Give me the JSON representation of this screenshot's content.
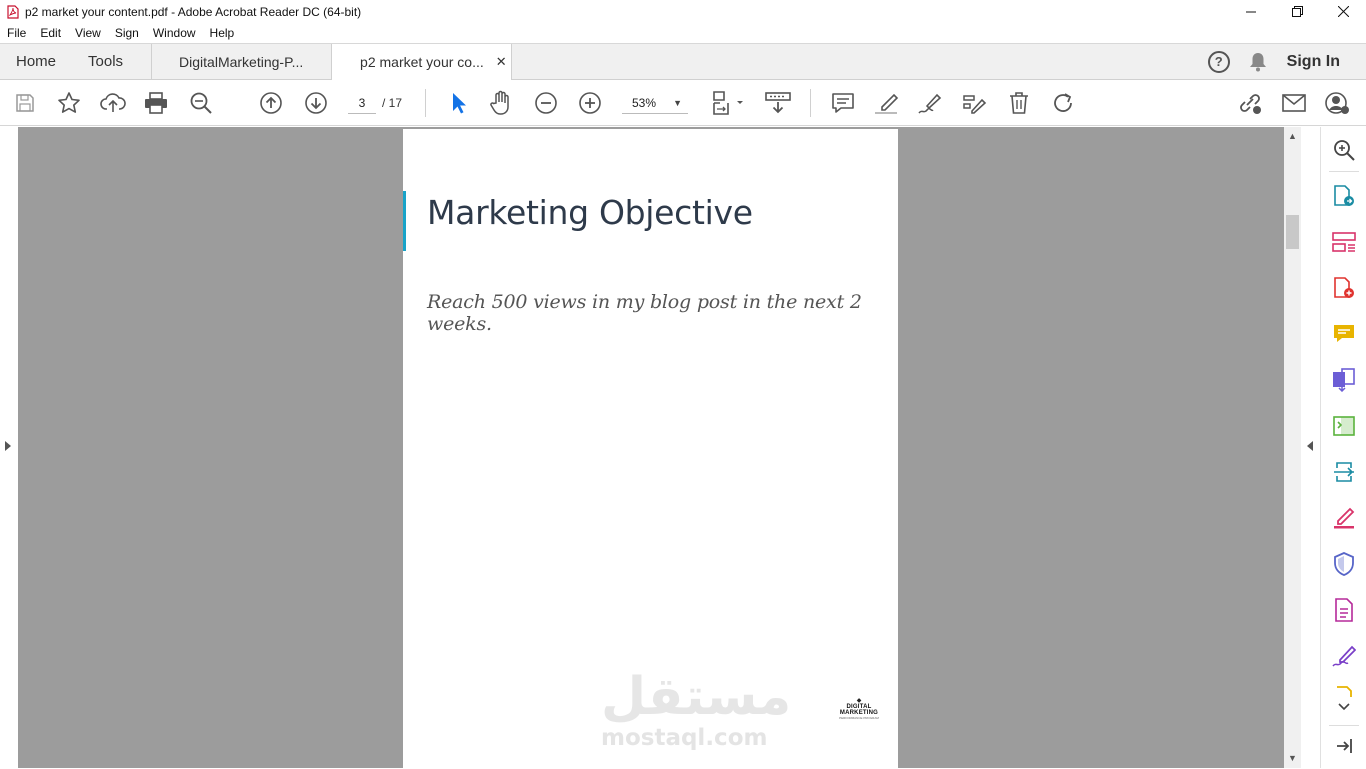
{
  "window": {
    "title": "p2 market your content.pdf - Adobe Acrobat Reader DC (64-bit)",
    "minimize": "—",
    "maximize": "❐",
    "close": "✕"
  },
  "menu": [
    "File",
    "Edit",
    "View",
    "Sign",
    "Window",
    "Help"
  ],
  "tabs": {
    "home": "Home",
    "tools": "Tools",
    "documents": [
      {
        "label": "DigitalMarketing-P...",
        "active": false
      },
      {
        "label": "p2 market your co...",
        "active": true,
        "close": "✕"
      }
    ],
    "help": "?",
    "sign_in": "Sign In"
  },
  "toolbar": {
    "current_page": "3",
    "page_total": "/ 17",
    "zoom": "53%",
    "zoom_caret": "▼",
    "icons": [
      "save-icon",
      "bookmark-star-icon",
      "upload-cloud-icon",
      "print-icon",
      "find-zoom-icon",
      "prev-page-icon",
      "next-page-icon",
      "select-cursor-icon",
      "hand-icon",
      "zoom-out-icon",
      "zoom-in-icon",
      "page-fit-icon",
      "scroll-mode-icon",
      "comment-icon",
      "highlight-icon",
      "draw-icon",
      "fill-sign-icon",
      "delete-icon",
      "rotate-icon",
      "share-link-icon",
      "email-icon",
      "share-user-icon"
    ]
  },
  "document": {
    "heading": "Marketing Objective",
    "body": "Reach 500 views in my blog post in the next 2 weeks.",
    "watermark_arabic": "مستقل",
    "watermark_url": "mostaql.com",
    "logo_text": "DIGITAL MARKETING",
    "logo_sub": "PERFORMANCE PROGRAM",
    "accent_color": "#19a3c8"
  },
  "scrollbar": {
    "up": "▲",
    "down": "▼"
  },
  "tools_pane": {
    "icons": [
      "search-zoom-icon",
      "export-pdf-icon",
      "organize-pages-icon",
      "create-pdf-icon",
      "comment-tool-icon",
      "combine-files-icon",
      "edit-pdf-icon",
      "send-review-icon",
      "fill-sign-tool-icon",
      "protect-icon",
      "more-tools-icon",
      "request-signature-icon",
      "expand-more-icon",
      "collapse-pane-icon"
    ],
    "more": "⌄"
  }
}
